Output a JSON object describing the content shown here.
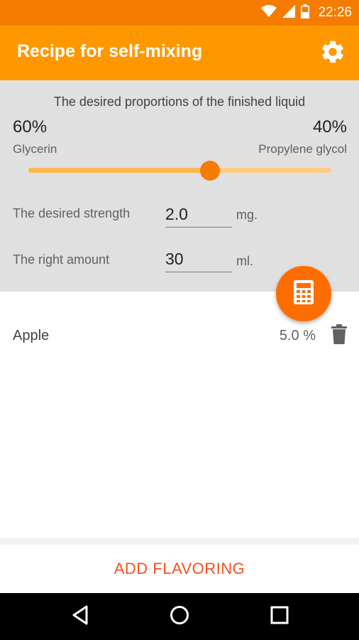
{
  "status_bar": {
    "time": "22:26",
    "icons": [
      "wifi-icon",
      "signal-icon",
      "battery-icon"
    ]
  },
  "app_bar": {
    "title": "Recipe for self-mixing",
    "settings_icon": "gear-icon"
  },
  "proportions": {
    "title": "The desired proportions of the finished liquid",
    "left_percent": "60%",
    "left_label": "Glycerin",
    "right_percent": "40%",
    "right_label": "Propylene glycol",
    "slider_fraction": 0.6
  },
  "strength": {
    "label": "The desired strength",
    "value": "2.0",
    "unit": "mg."
  },
  "amount": {
    "label": "The right amount",
    "value": "30",
    "unit": "ml."
  },
  "fab": {
    "icon": "calculator-icon"
  },
  "flavorings": [
    {
      "name": "Apple",
      "percent": "5.0 %",
      "delete_icon": "trash-icon"
    }
  ],
  "add_button": {
    "label": "ADD FLAVORING"
  },
  "nav": {
    "icons": [
      "back-icon",
      "home-icon",
      "recents-icon"
    ]
  },
  "colors": {
    "primary": "#ff9800",
    "primary_dark": "#f57c00",
    "accent": "#ff6d00",
    "button_text": "#f4511e"
  }
}
